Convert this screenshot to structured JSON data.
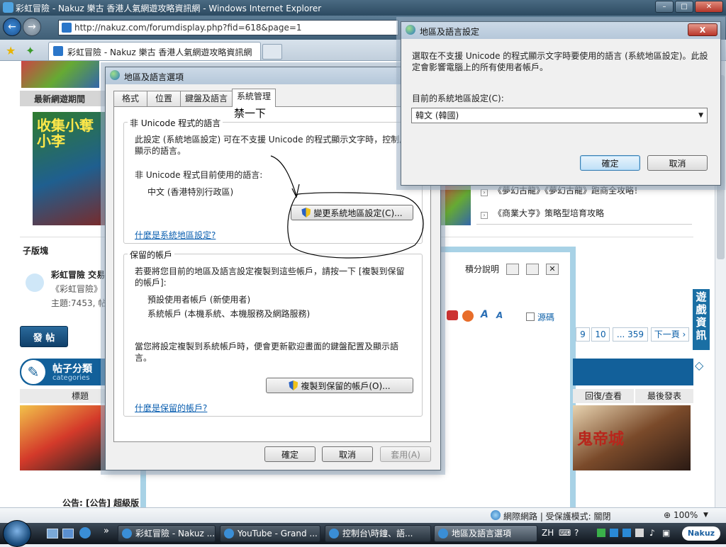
{
  "ie": {
    "title": "彩虹冒險 - Nakuz 樂古 香港人氣網遊攻略資訊網 - Windows Internet Explorer",
    "url": "http://nakuz.com/forumdisplay.php?fid=618&page=1",
    "tab_title": "彩虹冒險 - Nakuz 樂古 香港人氣網遊攻略資訊網",
    "minimize": "–",
    "maximize": "□",
    "close": "✕",
    "back": "←",
    "forward": "→",
    "fav_star": "★",
    "fav_add": "✦"
  },
  "page": {
    "latest_games_header": "最新網遊期間",
    "sub_forum_header": "子版塊",
    "forum_name": "彩虹冒險 交易",
    "forum_desc": "《彩虹冒險》",
    "forum_stats": "主題:7453, 帖",
    "links": [
      "《夢幻古龍》《夢幻古龍》跑商全攻略！",
      "《商業大亨》策略型培育攻略"
    ],
    "credits_label": "積分說明",
    "source_code_label": "源碼",
    "post_button": "發 帖",
    "categories_title": "帖子分類",
    "categories_sub": "categories",
    "col_title": "標題",
    "col_replies": "回復/查看",
    "col_last": "最後發表",
    "pager": [
      "9",
      "10",
      "... 359",
      "下一頁 ›"
    ],
    "side_tab": "遊戲資訊",
    "promo_text": "收集小奪小李",
    "promo_text2": "鬼帝城",
    "footer_text": "公告: [公告] 超級版"
  },
  "regional_dialog": {
    "title": "地區及語言選項",
    "tabs": [
      "格式",
      "位置",
      "鍵盤及語言",
      "系統管理"
    ],
    "annotation": "禁一下",
    "group1_legend": "非 Unicode 程式的語言",
    "group1_desc": "此設定 (系統地區設定) 可在不支援 Unicode 的程式顯示文字時，控制用來顯示的語言。",
    "current_lang_label": "非 Unicode 程式目前使用的語言:",
    "current_lang_value": "中文 (香港特別行政區)",
    "change_locale_button": "變更系統地區設定(C)...",
    "what_is_locale_link": "什麼是系統地區設定?",
    "group2_legend": "保留的帳戶",
    "group2_desc": "若要將您目前的地區及語言設定複製到這些帳戶，請按一下 [複製到保留的帳戶]:",
    "account_default": "預設使用者帳戶 (新使用者)",
    "account_system": "系統帳戶 (本機系統、本機服務及網路服務)",
    "copy_note": "當您將設定複製到系統帳戶時，便會更新歡迎畫面的鍵盤配置及顯示語言。",
    "copy_button": "複製到保留的帳戶(O)...",
    "what_is_reserved_link": "什麼是保留的帳戶?",
    "ok": "確定",
    "cancel": "取消",
    "apply": "套用(A)"
  },
  "locale_dialog": {
    "title": "地區及語言設定",
    "close": "X",
    "desc": "選取在不支援 Unicode 的程式顯示文字時要使用的語言 (系統地區設定)。此設定會影響電腦上的所有使用者帳戶。",
    "select_label": "目前的系統地區設定(C):",
    "selected_value": "韓文 (韓國)",
    "ok": "確定",
    "cancel": "取消"
  },
  "statusbar": {
    "zone": "網際網路 | 受保護模式: 關閉",
    "zoom": "100%"
  },
  "taskbar": {
    "items": [
      "彩虹冒險 - Nakuz ...",
      "YouTube - Grand ...",
      "控制台\\時鐘、語...",
      "地區及語言選項"
    ],
    "lang": "ZH",
    "chevron": "»",
    "nakuz_badge": "Nakuz"
  },
  "colors": {
    "dialog_bg": "#f0f0f0",
    "link": "#0b5fb0",
    "accent_blue": "#12609a"
  }
}
